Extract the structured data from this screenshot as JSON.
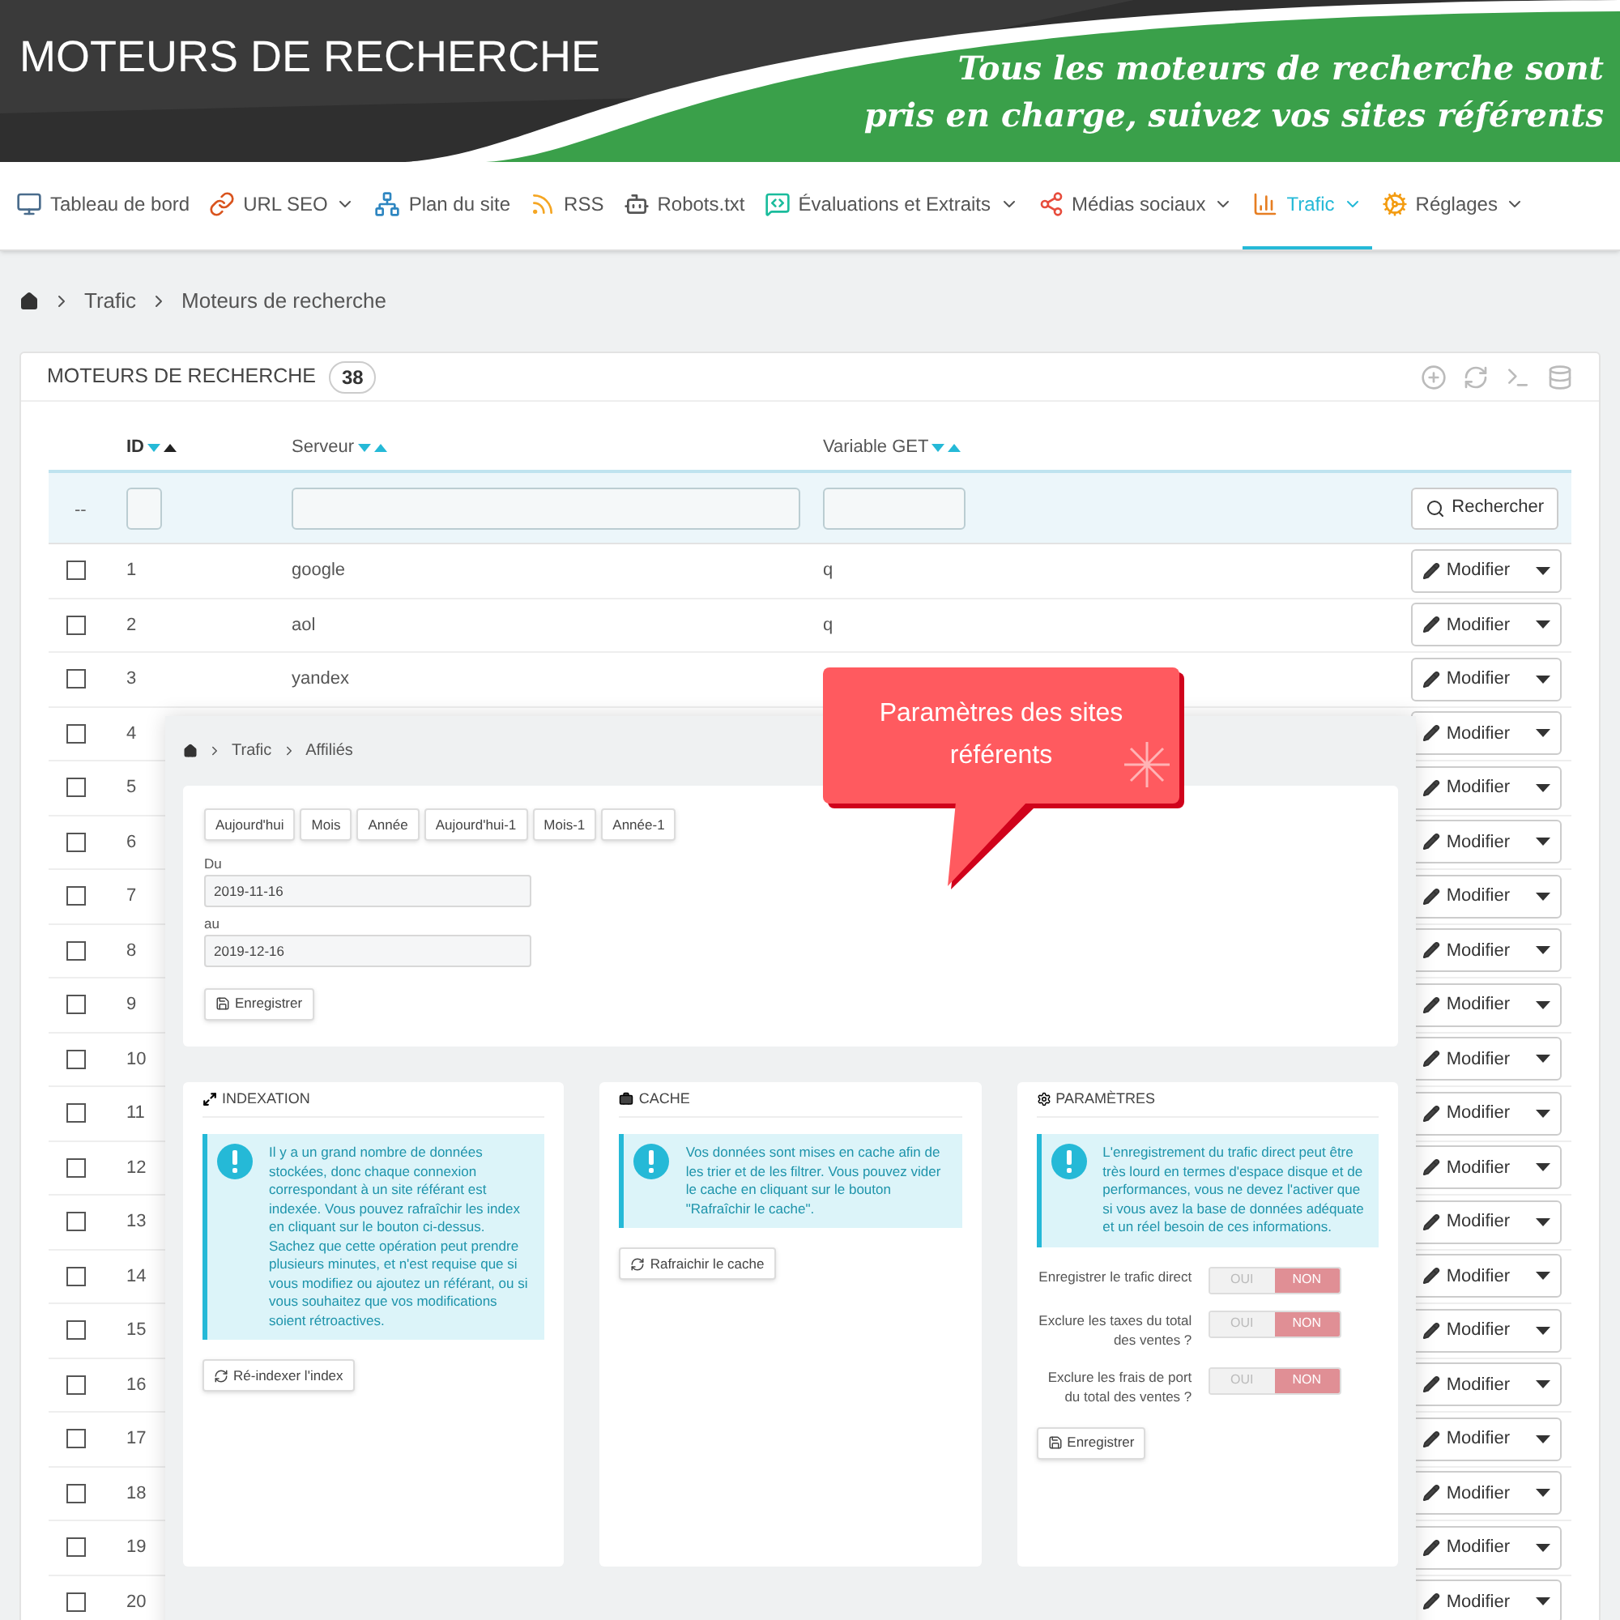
{
  "banner": {
    "title": "MOTEURS DE RECHERCHE",
    "tagline": [
      "Tous les moteurs de recherche sont",
      "pris en charge, suivez vos sites référents"
    ]
  },
  "nav": [
    {
      "label": "Tableau de bord",
      "dropdown": false,
      "selected": false
    },
    {
      "label": "URL SEO",
      "dropdown": true,
      "selected": false
    },
    {
      "label": "Plan du site",
      "dropdown": false,
      "selected": false
    },
    {
      "label": "RSS",
      "dropdown": false,
      "selected": false
    },
    {
      "label": "Robots.txt",
      "dropdown": false,
      "selected": false
    },
    {
      "label": "Évaluations et Extraits",
      "dropdown": true,
      "selected": false
    },
    {
      "label": "Médias sociaux",
      "dropdown": true,
      "selected": false
    },
    {
      "label": "Trafic",
      "dropdown": true,
      "selected": true
    },
    {
      "label": "Réglages",
      "dropdown": true,
      "selected": false
    }
  ],
  "breadcrumb": [
    "Trafic",
    "Moteurs de recherche"
  ],
  "panel": {
    "title": "MOTEURS DE RECHERCHE",
    "count": "38"
  },
  "table": {
    "columns": [
      {
        "label": "ID",
        "sort_active": true
      },
      {
        "label": "Serveur",
        "sort_active": false
      },
      {
        "label": "Variable GET",
        "sort_active": false
      }
    ],
    "filter_placeholder": "--",
    "search_button": "Rechercher",
    "rows": [
      {
        "checked": false,
        "id": "1",
        "server": "google",
        "variable": "q",
        "action": "Modifier"
      },
      {
        "checked": false,
        "id": "2",
        "server": "aol",
        "variable": "q",
        "action": "Modifier"
      },
      {
        "checked": false,
        "id": "3",
        "server": "yandex",
        "action": "Modifier"
      },
      {
        "checked": false,
        "id": "4",
        "action": "Modifier"
      },
      {
        "checked": false,
        "id": "5",
        "action": "Modifier"
      },
      {
        "checked": false,
        "id": "6",
        "action": "Modifier"
      },
      {
        "checked": false,
        "id": "7",
        "action": "Modifier"
      },
      {
        "checked": false,
        "id": "8",
        "action": "Modifier"
      },
      {
        "checked": false,
        "id": "9",
        "action": "Modifier"
      },
      {
        "checked": false,
        "id": "10",
        "action": "Modifier"
      },
      {
        "checked": false,
        "id": "11",
        "action": "Modifier"
      },
      {
        "checked": false,
        "id": "12",
        "action": "Modifier"
      },
      {
        "checked": false,
        "id": "13",
        "action": "Modifier"
      },
      {
        "checked": false,
        "id": "14",
        "action": "Modifier"
      },
      {
        "checked": false,
        "id": "15",
        "action": "Modifier"
      },
      {
        "checked": false,
        "id": "16",
        "action": "Modifier"
      },
      {
        "checked": false,
        "id": "17",
        "action": "Modifier"
      },
      {
        "checked": false,
        "id": "18",
        "action": "Modifier"
      },
      {
        "checked": false,
        "id": "19",
        "action": "Modifier"
      },
      {
        "checked": false,
        "id": "20",
        "action": "Modifier"
      }
    ]
  },
  "overlay": {
    "breadcrumb": [
      "Trafic",
      "Affiliés"
    ],
    "date_buttons": [
      "Aujourd'hui",
      "Mois",
      "Année",
      "Aujourd'hui-1",
      "Mois-1",
      "Année-1"
    ],
    "from_label": "Du",
    "from_value": "2019-11-16",
    "to_label": "au",
    "to_value": "2019-12-16",
    "save": "Enregistrer",
    "indexation": {
      "title": "INDEXATION",
      "message": "Il y a un grand nombre de données stockées, donc chaque connexion correspondant à un site référant est indexée. Vous pouvez rafraîchir les index en cliquant sur le bouton ci-dessus. Sachez que cette opération peut prendre plusieurs minutes, et n'est requise que si vous modifiez ou ajoutez un référant, ou si vous souhaitez que vos modifications soient rétroactives.",
      "button": "Ré-indexer l'index"
    },
    "cache": {
      "title": "CACHE",
      "message": "Vos données sont mises en cache afin de les trier et de les filtrer. Vous pouvez vider le cache en cliquant sur le bouton \"Rafraîchir le cache\".",
      "button": "Rafraichir le cache"
    },
    "settings": {
      "title": "PARAMÈTRES",
      "message": "L'enregistrement du trafic direct peut être très lourd en termes d'espace disque et de performances, vous ne devez l'activer que si vous avez la base de données adéquate et un réel besoin de ces informations.",
      "toggles": [
        {
          "label": "Enregistrer le trafic direct",
          "on": false,
          "yes": "OUI",
          "no": "NON"
        },
        {
          "label": "Exclure les taxes du total des ventes ?",
          "on": false,
          "yes": "OUI",
          "no": "NON"
        },
        {
          "label": "Exclure les frais de port du total des ventes ?",
          "on": false,
          "yes": "OUI",
          "no": "NON"
        }
      ],
      "save": "Enregistrer"
    }
  },
  "callout": {
    "text": "Paramètres des sites référents"
  }
}
